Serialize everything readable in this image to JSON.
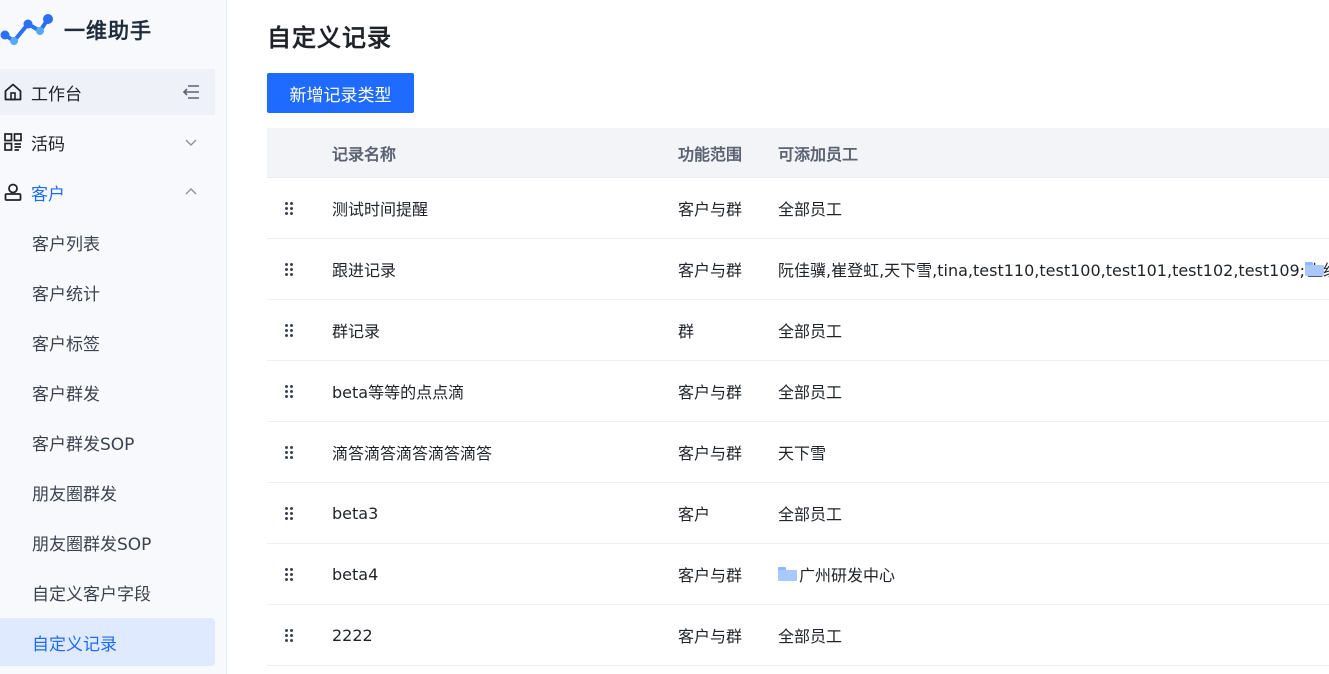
{
  "app": {
    "name": "一维助手"
  },
  "sidebar": {
    "workbench": {
      "label": "工作台"
    },
    "groups": [
      {
        "label": "活码",
        "expanded": false
      },
      {
        "label": "客户",
        "expanded": true
      }
    ],
    "sub_items": [
      {
        "label": "客户列表"
      },
      {
        "label": "客户统计"
      },
      {
        "label": "客户标签"
      },
      {
        "label": "客户群发"
      },
      {
        "label": "客户群发SOP"
      },
      {
        "label": "朋友圈群发"
      },
      {
        "label": "朋友圈群发SOP"
      },
      {
        "label": "自定义客户字段"
      },
      {
        "label": "自定义记录",
        "selected": true
      }
    ]
  },
  "main": {
    "title": "自定义记录",
    "add_button": "新增记录类型",
    "columns": [
      "记录名称",
      "功能范围",
      "可添加员工"
    ],
    "rows": [
      {
        "name": "测试时间提醒",
        "scope": "客户与群",
        "staff": "全部员工"
      },
      {
        "name": "跟进记录",
        "scope": "客户与群",
        "staff": "阮佳骥,崔登虹,天下雪,tina,test110,test100,test101,test102,test109;",
        "staff_folder": "上级"
      },
      {
        "name": "群记录",
        "scope": "群",
        "staff": "全部员工"
      },
      {
        "name": "beta等等的点点滴",
        "scope": "客户与群",
        "staff": "全部员工"
      },
      {
        "name": "滴答滴答滴答滴答滴答",
        "scope": "客户与群",
        "staff": "天下雪"
      },
      {
        "name": "beta3",
        "scope": "客户",
        "staff": "全部员工"
      },
      {
        "name": "beta4",
        "scope": "客户与群",
        "staff_folder_lead": "广州研发中心"
      },
      {
        "name": "2222",
        "scope": "客户与群",
        "staff": "全部员工"
      }
    ]
  },
  "colors": {
    "primary": "#1f6bff",
    "sidebar_bg": "#f7f9fc",
    "selected_bg": "#dfeafe",
    "header_bg": "#f2f4f8"
  }
}
